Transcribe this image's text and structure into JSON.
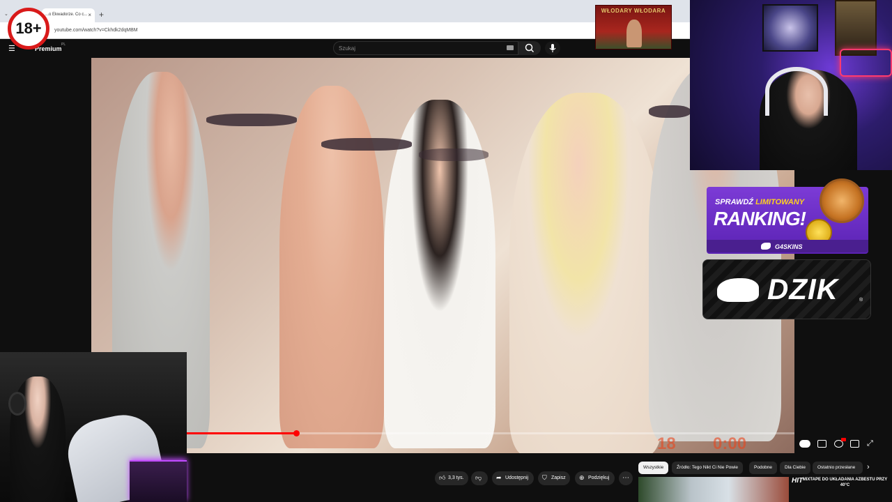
{
  "browser": {
    "tab_title": "...o Ekwadorze. Co c...",
    "tab_close": "×",
    "new_tab": "+",
    "tab_menu": "⌄",
    "url": "youtube.com/watch?v=Ckhdk2dqMBM"
  },
  "youtube": {
    "logo_text": "Premium",
    "logo_region": "PL",
    "search_placeholder": "Szukaj"
  },
  "overlays": {
    "age_badge": "18+",
    "channel_logo_text": "WŁODARY WŁODARA",
    "promo_line1_prefix": "SPRAWDŹ ",
    "promo_line1_highlight": "LIMITOWANY",
    "promo_line2": "RANKING!",
    "promo_brand": "G4SKINS",
    "sponsor_brand": "DZIK",
    "sponsor_reg": "®"
  },
  "player": {
    "progress_fraction": 0.18,
    "video_stamp_num": "18",
    "video_stamp_time": "0:00"
  },
  "actions": {
    "like_count": "3,3 tys.",
    "share": "Udostępnij",
    "save": "Zapisz",
    "thanks": "Podziękuj",
    "more": "⋯"
  },
  "chips": [
    "Wszystkie",
    "Źródło: Tego Nikt Ci Nie Powie",
    "Podobne",
    "Dla Ciebie",
    "Ostatnio przesłane"
  ],
  "related": {
    "brand": "HIT",
    "title": "MIXTAPE DO UKŁADANIA AZBESTU PRZY 40°C"
  },
  "colors": {
    "progress": "#ff0000",
    "badge_ring": "#d91a1a",
    "promo_bg": "#7c3bd6",
    "promo_highlight": "#ffd21f"
  }
}
